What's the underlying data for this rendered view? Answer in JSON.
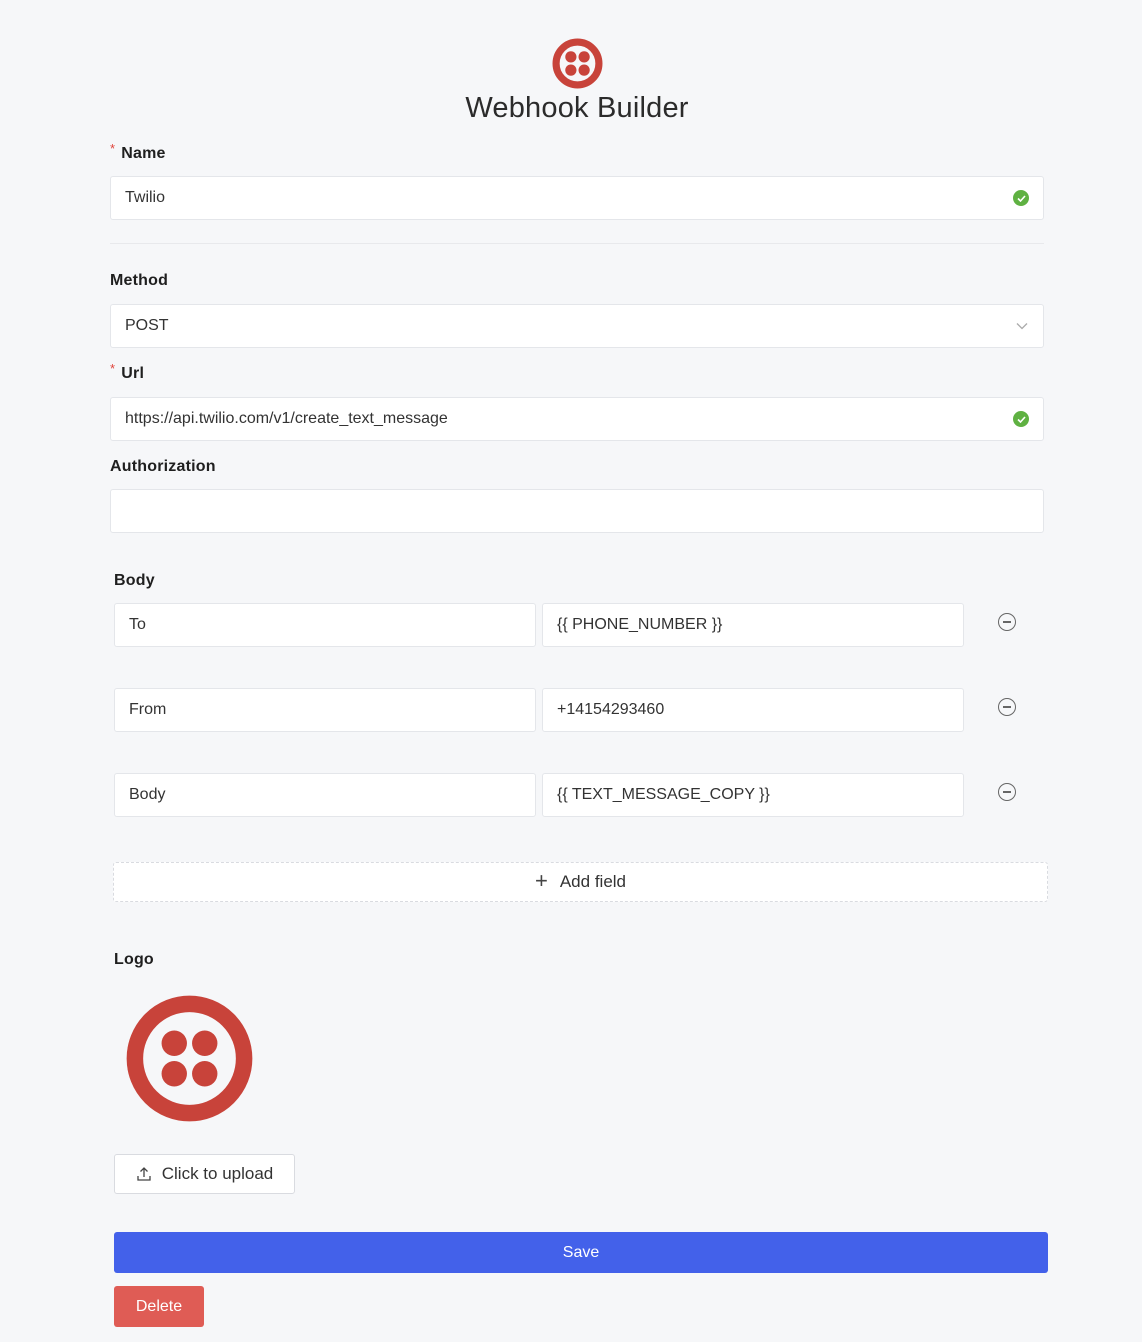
{
  "header": {
    "title": "Webhook Builder",
    "logo_icon": "twilio-logo-icon"
  },
  "form": {
    "name": {
      "label": "Name",
      "required_mark": "*",
      "value": "Twilio",
      "valid": true
    },
    "method": {
      "label": "Method",
      "value": "POST"
    },
    "url": {
      "label": "Url",
      "required_mark": "*",
      "value": "https://api.twilio.com/v1/create_text_message",
      "valid": true
    },
    "authorization": {
      "label": "Authorization",
      "value": ""
    },
    "body": {
      "label": "Body",
      "fields": [
        {
          "key": "To",
          "value": "{{ PHONE_NUMBER }}"
        },
        {
          "key": "From",
          "value": "+14154293460"
        },
        {
          "key": "Body",
          "value": "{{ TEXT_MESSAGE_COPY }}"
        }
      ],
      "add_field_label": "Add field"
    },
    "logo": {
      "label": "Logo",
      "upload_label": "Click to upload"
    }
  },
  "actions": {
    "save_label": "Save",
    "delete_label": "Delete"
  },
  "colors": {
    "brand_red": "#c8433a",
    "primary_blue": "#4361ea",
    "danger_red": "#df5c55",
    "success_green": "#5fb142"
  }
}
